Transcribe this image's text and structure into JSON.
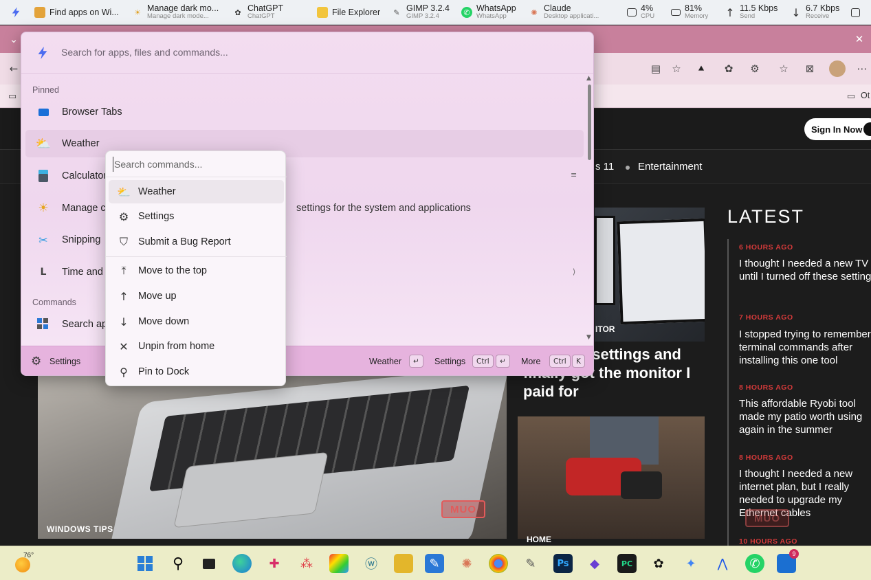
{
  "top_taskbar": {
    "items": [
      {
        "title": "Find apps on Wi...",
        "subtitle": ""
      },
      {
        "title": "Manage dark mo...",
        "subtitle": "Manage dark mode..."
      },
      {
        "title": "ChatGPT",
        "subtitle": "ChatGPT"
      },
      {
        "title": "File Explorer",
        "subtitle": ""
      },
      {
        "title": "GIMP 3.2.4",
        "subtitle": "GIMP 3.2.4"
      },
      {
        "title": "WhatsApp",
        "subtitle": "WhatsApp"
      },
      {
        "title": "Claude",
        "subtitle": "Desktop applicati..."
      }
    ],
    "stats": [
      {
        "value": "4%",
        "label": "CPU"
      },
      {
        "value": "81%",
        "label": "Memory"
      },
      {
        "value": "11.5 Kbps",
        "label": "Send"
      },
      {
        "value": "6.7 Kbps",
        "label": "Receive"
      }
    ]
  },
  "browser": {
    "favbar_item": "Ot"
  },
  "website": {
    "signin_label": "Sign In Now",
    "nav_partial": "s 11",
    "nav_entertainment": "Entertainment",
    "hero_category": "WINDOWS TIPS",
    "mid_category": "ITOR",
    "mid_title": "3 display settings and finally got the monitor I paid for",
    "mid_category2": "HOME",
    "muo_logo": "MUO",
    "latest_heading": "LATEST",
    "latest": [
      {
        "time": "6 HOURS AGO",
        "title": "I thought I needed a new TV until I turned off these settings"
      },
      {
        "time": "7 HOURS AGO",
        "title": "I stopped trying to remember terminal commands after installing this one tool"
      },
      {
        "time": "8 HOURS AGO",
        "title": "This affordable Ryobi tool made my patio worth using again in the summer"
      },
      {
        "time": "8 HOURS AGO",
        "title": "I thought I needed a new internet plan, but I really needed to upgrade my Ethernet cables"
      },
      {
        "time": "10 HOURS AGO",
        "title": ""
      }
    ]
  },
  "launcher": {
    "search_placeholder": "Search for apps, files and commands...",
    "pinned_label": "Pinned",
    "commands_label": "Commands",
    "items": [
      {
        "label": "Browser Tabs",
        "subtitle": ""
      },
      {
        "label": "Weather",
        "subtitle": ""
      },
      {
        "label": "Calculator",
        "subtitle": ""
      },
      {
        "label": "Manage c",
        "subtitle": "settings for the system and applications"
      },
      {
        "label": "Snipping",
        "subtitle": ""
      },
      {
        "label": "Time and",
        "subtitle": ""
      }
    ],
    "command_items": [
      {
        "label": "Search ap"
      }
    ],
    "footer": {
      "settings_label": "Settings",
      "action1": "Weather",
      "action2": "Settings",
      "action2_key": "Ctrl",
      "action3": "More",
      "action3_key1": "Ctrl",
      "action3_key2": "K",
      "enter_symbol": "↵"
    }
  },
  "context_menu": {
    "search_placeholder": "Search commands...",
    "items": [
      {
        "label": "Weather",
        "icon": "weather-icon"
      },
      {
        "label": "Settings",
        "icon": "gear-icon"
      },
      {
        "label": "Submit a Bug Report",
        "icon": "shield-icon"
      },
      {
        "label": "Move to the top",
        "icon": "arrow-top-icon"
      },
      {
        "label": "Move up",
        "icon": "arrow-up-icon"
      },
      {
        "label": "Move down",
        "icon": "arrow-down-icon"
      },
      {
        "label": "Unpin from home",
        "icon": "unpin-icon"
      },
      {
        "label": "Pin to Dock",
        "icon": "pin-icon"
      }
    ]
  },
  "bottom_taskbar": {
    "temperature": "76°",
    "notification_count": "9"
  }
}
